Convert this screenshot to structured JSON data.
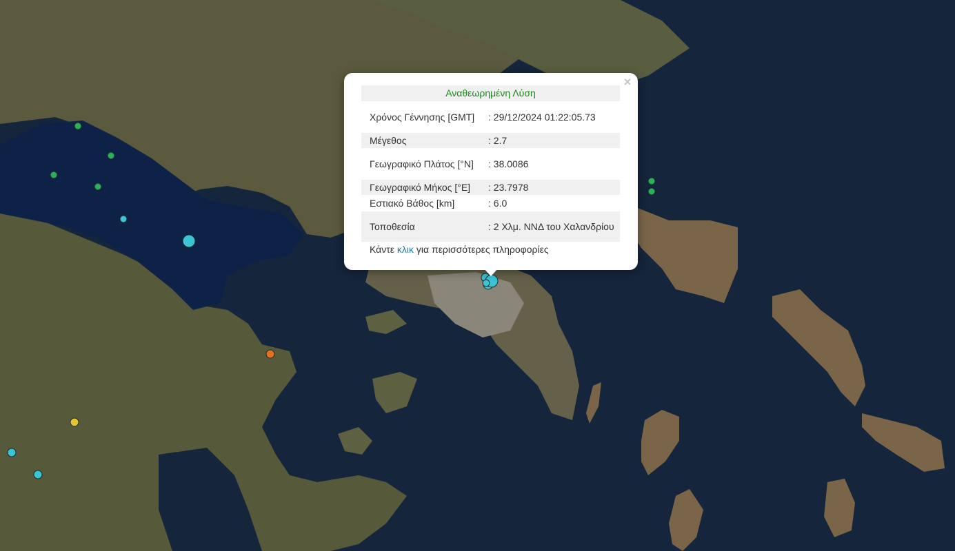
{
  "popup": {
    "title": "Αναθεωρημένη Λύση",
    "close_symbol": "×",
    "rows": [
      {
        "label": "Χρόνος Γέννησης [GMT]",
        "value": ": 29/12/2024 01:22:05.73"
      },
      {
        "label": "Μέγεθος",
        "value": ": 2.7"
      },
      {
        "label": "Γεωγραφικό Πλάτος [°N]",
        "value": ": 38.0086"
      },
      {
        "label": "Γεωγραφικό Μήκος [°E]",
        "value": ": 23.7978"
      },
      {
        "label": "Εστιακό Βάθος [km]",
        "value": ": 6.0"
      },
      {
        "label": "Τοποθεσία",
        "value": ": 2 Χλμ. ΝΝΔ του Χαλανδρίου"
      }
    ],
    "more_prefix": "Κάντε ",
    "more_link": "κλικ",
    "more_suffix": " για περισσότερες πληροφορίες"
  },
  "colors": {
    "sea": "#15263c",
    "land": "#5b5a3e",
    "popup_title": "#1a8a1a",
    "link": "#1a7bb0",
    "quake_cyan": "#3cc3d6",
    "quake_green": "#2bb05a",
    "quake_orange": "#e2701f",
    "quake_yellow": "#e6c531"
  },
  "earthquakes": [
    {
      "name": "quake-marker-cyan",
      "color": "quake_cyan"
    },
    {
      "name": "quake-marker-green",
      "color": "quake_green"
    },
    {
      "name": "quake-marker-orange",
      "color": "quake_orange"
    },
    {
      "name": "quake-marker-yellow",
      "color": "quake_yellow"
    }
  ]
}
